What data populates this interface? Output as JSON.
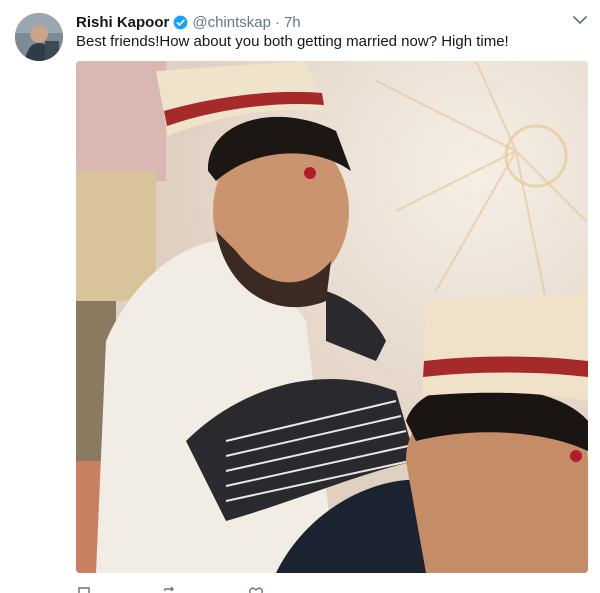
{
  "tweet": {
    "author_name": "Rishi Kapoor",
    "handle": "@chintskap",
    "separator": "·",
    "time": "7h",
    "text": "Best friends!How about you both getting married now? High time!"
  },
  "icons": {
    "verified": "verified-badge-icon",
    "menu": "chevron-down-icon",
    "reply": "reply-icon",
    "retweet": "retweet-icon",
    "like": "like-icon"
  },
  "colors": {
    "verified": "#1da1f2",
    "secondary_text": "#657786",
    "primary_text": "#14171a"
  }
}
